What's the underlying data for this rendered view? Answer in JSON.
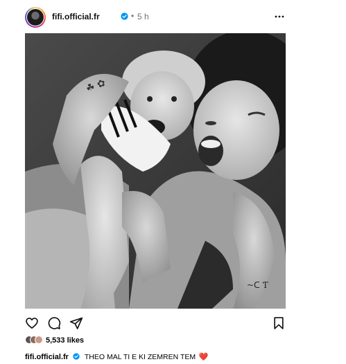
{
  "header": {
    "username": "fifi.official.fr",
    "separator": "•",
    "time": "5 h"
  },
  "icons": {
    "verified": "verified-badge-icon",
    "more": "more-options-icon",
    "like": "heart-outline-icon",
    "comment": "comment-bubble-icon",
    "share": "paper-plane-icon",
    "save": "bookmark-outline-icon"
  },
  "post": {
    "image": "black-and-white photo of a smiling woman and a toddler with a pacifier"
  },
  "likes": {
    "text": "5,533 likes"
  },
  "caption": {
    "username": "fifi.official.fr",
    "text": "THEO MAL TI E KI ZEMREN TEM",
    "emoji": "❤️"
  },
  "colors": {
    "verified_blue": "#0095f6",
    "muted_text": "#737373",
    "heart_red": "#e02020"
  }
}
